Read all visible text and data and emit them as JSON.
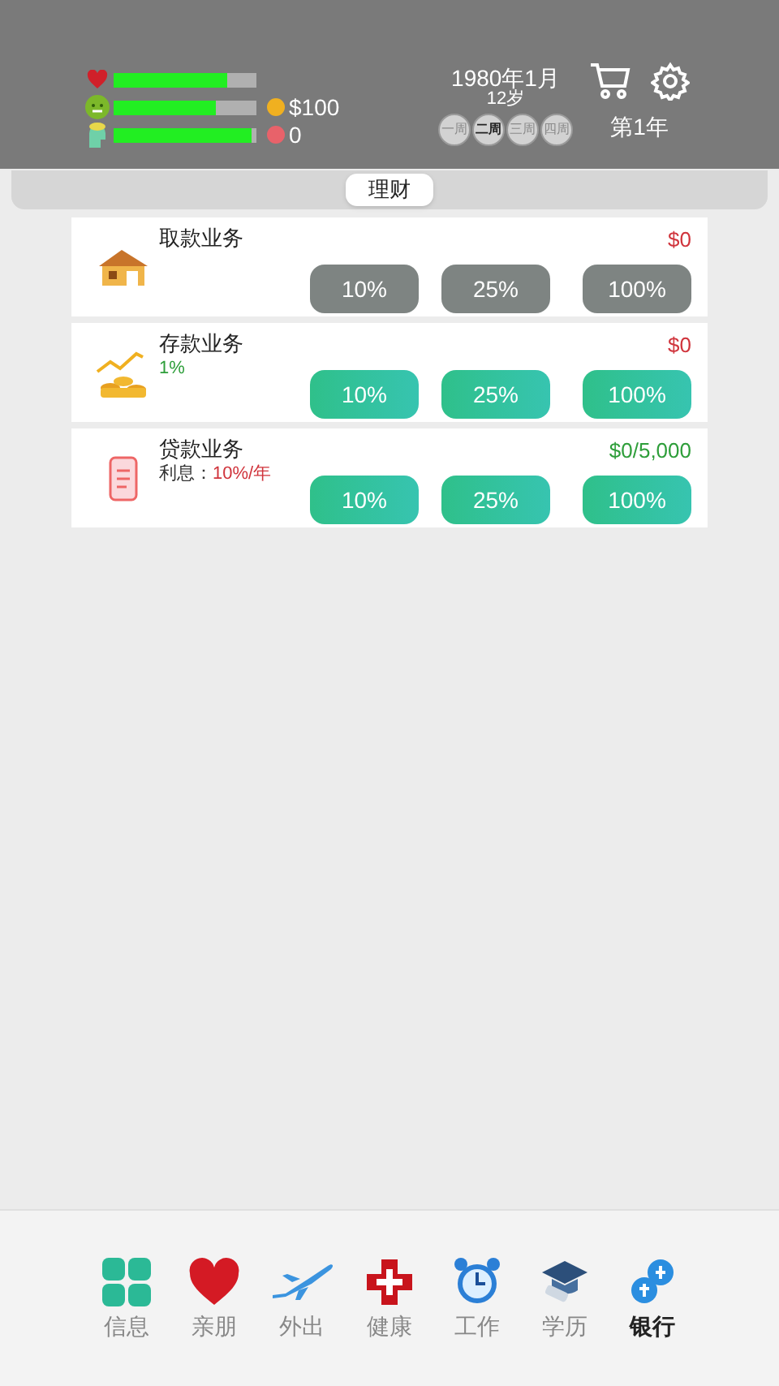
{
  "status": {
    "bars": [
      {
        "level": 0.8
      },
      {
        "level": 0.72
      },
      {
        "level": 0.97
      }
    ],
    "money": "$100",
    "hearts": "0",
    "date": "1980年1月",
    "age": "12岁",
    "weeks": [
      {
        "label": "一周",
        "selected": false
      },
      {
        "label": "二周",
        "selected": true
      },
      {
        "label": "三周",
        "selected": false
      },
      {
        "label": "四周",
        "selected": false
      }
    ],
    "year": "第1年"
  },
  "tabs": [
    {
      "label": "理财",
      "selected": true
    }
  ],
  "services": [
    {
      "title": "取款业务",
      "amount": {
        "text": "$0",
        "color": "#d0343c"
      },
      "buttons": [
        {
          "label": "10%",
          "disabled": true
        },
        {
          "label": "25%",
          "disabled": true
        },
        {
          "label": "100%",
          "disabled": true
        }
      ]
    },
    {
      "title": "存款业务",
      "note": {
        "value": "1%",
        "color": "#2e9e3a"
      },
      "amount": {
        "text": "$0",
        "color": "#d0343c"
      },
      "buttons": [
        {
          "label": "10%",
          "disabled": false
        },
        {
          "label": "25%",
          "disabled": false
        },
        {
          "label": "100%",
          "disabled": false
        }
      ]
    },
    {
      "title": "贷款业务",
      "note": {
        "label": "利息：",
        "value": "10%/年",
        "color": "#d0343c"
      },
      "amount": {
        "text": "$0/5,000",
        "color": "#2e9e3a"
      },
      "buttons": [
        {
          "label": "10%",
          "disabled": false
        },
        {
          "label": "25%",
          "disabled": false
        },
        {
          "label": "100%",
          "disabled": false
        }
      ]
    }
  ],
  "nav": [
    {
      "label": "信息",
      "selected": false
    },
    {
      "label": "亲朋",
      "selected": false
    },
    {
      "label": "外出",
      "selected": false
    },
    {
      "label": "健康",
      "selected": false
    },
    {
      "label": "工作",
      "selected": false
    },
    {
      "label": "学历",
      "selected": false
    },
    {
      "label": "银行",
      "selected": true
    }
  ]
}
